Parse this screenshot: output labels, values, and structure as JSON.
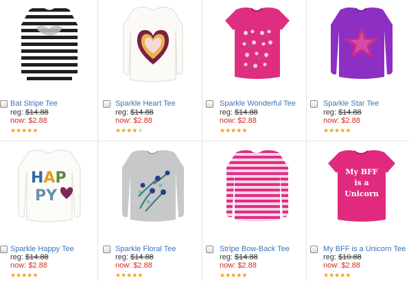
{
  "colors": {
    "title_link": "#3a74b5",
    "sale_price": "#d42a1a",
    "star_filled": "#f39b16",
    "star_empty": "#cfcfcf"
  },
  "products": [
    {
      "name": "Bat Stripe Tee",
      "reg_label": "reg:",
      "reg_price": "$14.88",
      "now_label": "now:",
      "now_price": "$2.88",
      "rating": 5,
      "image_icon": "striped-tee-icon"
    },
    {
      "name": "Sparkle Heart Tee",
      "reg_label": "reg:",
      "reg_price": "$14.88",
      "now_label": "now:",
      "now_price": "$2.88",
      "rating": 4,
      "image_icon": "heart-tee-icon"
    },
    {
      "name": "Sparkle Wonderful Tee",
      "reg_label": "reg:",
      "reg_price": "$14.88",
      "now_label": "now:",
      "now_price": "$2.88",
      "rating": 5,
      "image_icon": "pink-floral-tee-icon"
    },
    {
      "name": "Sparkle Star Tee",
      "reg_label": "reg:",
      "reg_price": "$14.88",
      "now_label": "now:",
      "now_price": "$2.88",
      "rating": 5,
      "image_icon": "star-tee-icon"
    },
    {
      "name": "Sparkle Happy Tee",
      "reg_label": "reg:",
      "reg_price": "$14.88",
      "now_label": "now:",
      "now_price": "$2.88",
      "rating": 5,
      "image_icon": "happy-tee-icon",
      "print_text": [
        "HAP",
        "PY"
      ]
    },
    {
      "name": "Sparkle Floral Tee",
      "reg_label": "reg:",
      "reg_price": "$14.88",
      "now_label": "now:",
      "now_price": "$2.88",
      "rating": 5,
      "image_icon": "floral-tee-icon"
    },
    {
      "name": "Stripe Bow-Back Tee",
      "reg_label": "reg:",
      "reg_price": "$14.88",
      "now_label": "now:",
      "now_price": "$2.88",
      "rating": 5,
      "image_icon": "pink-stripe-tee-icon"
    },
    {
      "name": "My BFF is a Unicorn Tee",
      "reg_label": "reg:",
      "reg_price": "$10.88",
      "now_label": "now:",
      "now_price": "$2.88",
      "rating": 5,
      "image_icon": "unicorn-text-tee-icon",
      "print_text": [
        "My BFF",
        "is a",
        "Unicorn"
      ]
    }
  ]
}
